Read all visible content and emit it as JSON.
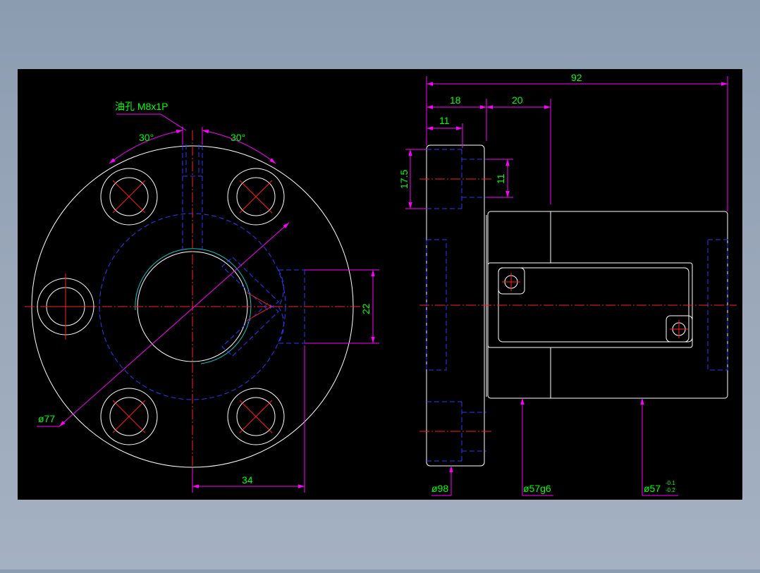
{
  "drawing": {
    "oil_hole_label": "油孔 M8x1P",
    "angle_left": "30°",
    "angle_right": "30°",
    "dia_77": "ø77",
    "dim_34": "34",
    "dim_22": "22",
    "dim_92": "92",
    "dim_18": "18",
    "dim_20": "20",
    "dim_11_top": "11",
    "dim_17_5": "17.5",
    "dim_11_vert": "11",
    "dia_98": "ø98",
    "dia_57g6": "ø57g6",
    "dia_57_tol": "ø57",
    "tol_upper": "-0.1",
    "tol_lower": "-0.2"
  },
  "colors": {
    "canvas": "#000000",
    "object_line": "#ffffff",
    "hidden_line": "#2a3cff",
    "center_line": "#ff1e1e",
    "dimension_line": "#ff00ff",
    "dimension_text": "#00ff00",
    "thread_line": "#00c8c8"
  }
}
